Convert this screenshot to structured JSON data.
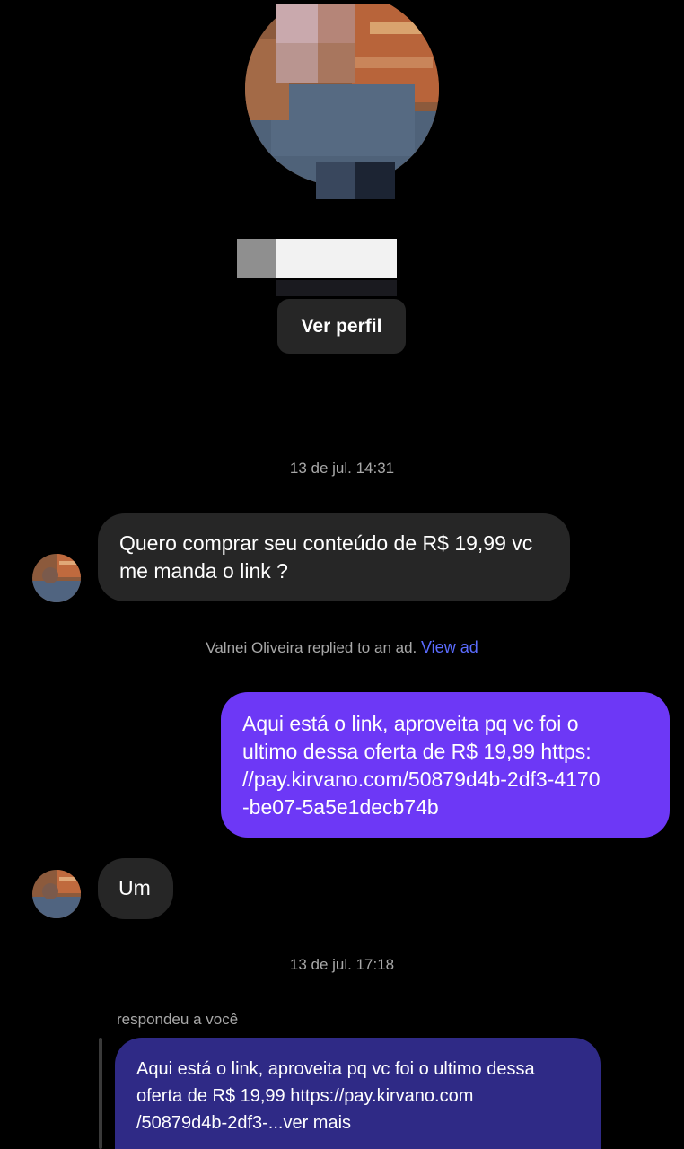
{
  "profile": {
    "view_profile_label": "Ver perfil"
  },
  "messages": {
    "timestamp_1": "13 de jul. 14:31",
    "incoming_1": "Quero comprar seu conteúdo de R$ 19,99 vc me manda o link ?",
    "ad_notice": "Valnei Oliveira replied to an ad.",
    "ad_link": "View ad",
    "outgoing_1_line1": "Aqui está o link, aproveita pq vc foi o",
    "outgoing_1_line2": "ultimo dessa oferta de R$ 19,99    https:",
    "outgoing_1_line3": "//pay.kirvano.com/50879d4b-2df3-4170",
    "outgoing_1_line4": "-be07-5a5e1decb74b",
    "incoming_2": "Um",
    "timestamp_2": "13 de jul. 17:18",
    "reply_label": "respondeu a você",
    "quoted_line1": "Aqui está o link, aproveita pq vc foi o ultimo dessa",
    "quoted_line2": "oferta de R$ 19,99    https://pay.kirvano.com",
    "quoted_line3": "/50879d4b-2df3-...ver mais"
  },
  "colors": {
    "background": "#000000",
    "incoming_bubble": "#262626",
    "outgoing_bubble": "#6d38f6",
    "quoted_bubble": "#2f2a86",
    "link": "#5b6cff",
    "muted_text": "#a8a8a8"
  }
}
